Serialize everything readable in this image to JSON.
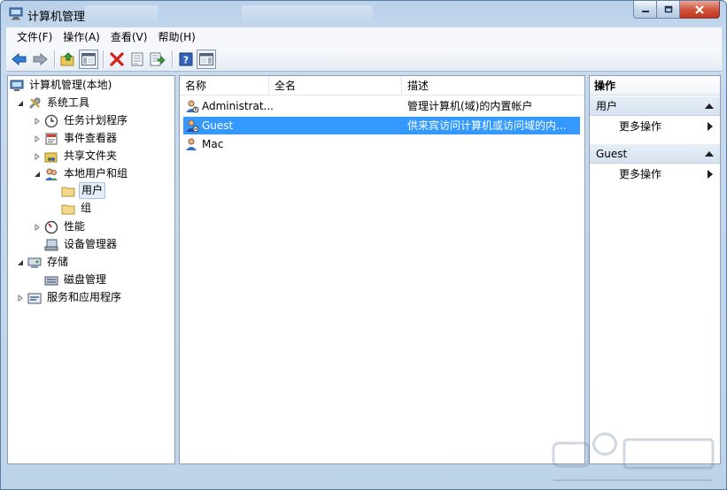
{
  "window": {
    "title": "计算机管理"
  },
  "menubar": {
    "items": [
      "文件(F)",
      "操作(A)",
      "查看(V)",
      "帮助(H)"
    ]
  },
  "toolbar": {
    "buttons": [
      "back-arrow-icon",
      "forward-arrow-icon",
      "up-folder-icon",
      "show-hide-tree-icon",
      "delete-icon",
      "properties-icon",
      "export-list-icon",
      "help-icon",
      "show-hide-action-pane-icon"
    ]
  },
  "tree": {
    "root": "计算机管理(本地)",
    "system_tools": "系统工具",
    "task_scheduler": "任务计划程序",
    "event_viewer": "事件查看器",
    "shared_folders": "共享文件夹",
    "local_users_groups": "本地用户和组",
    "users": "用户",
    "groups": "组",
    "performance": "性能",
    "device_manager": "设备管理器",
    "storage": "存储",
    "disk_management": "磁盘管理",
    "services_apps": "服务和应用程序"
  },
  "list": {
    "columns": {
      "name": "名称",
      "fullname": "全名",
      "description": "描述"
    },
    "rows": [
      {
        "name": "Administrat...",
        "fullname": "",
        "description": "管理计算机(域)的内置帐户"
      },
      {
        "name": "Guest",
        "fullname": "",
        "description": "供来宾访问计算机或访问域的内..."
      },
      {
        "name": "Mac",
        "fullname": "",
        "description": ""
      }
    ],
    "selected_index": 1
  },
  "actions": {
    "title": "操作",
    "section1": {
      "label": "用户",
      "item": "更多操作"
    },
    "section2": {
      "label": "Guest",
      "item": "更多操作"
    }
  },
  "colors": {
    "selection": "#3399ff",
    "titlebar": "#b9d1ea",
    "close_button": "#c2341c"
  }
}
